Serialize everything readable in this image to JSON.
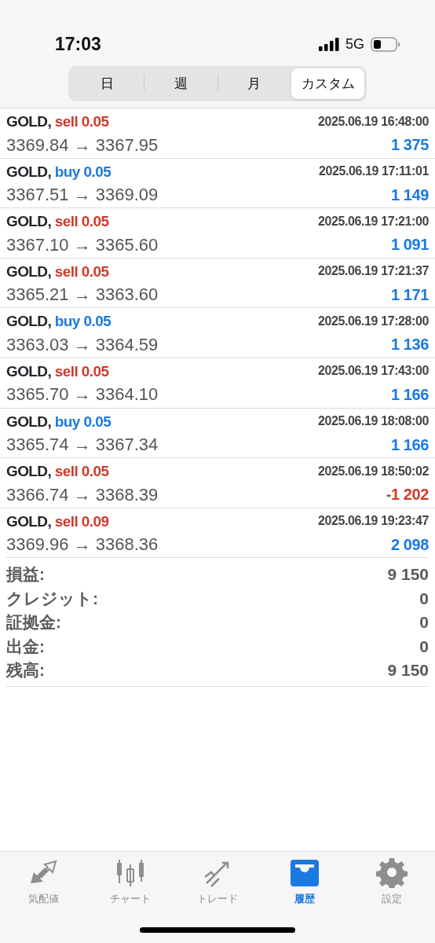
{
  "status_bar": {
    "time": "17:03",
    "network": "5G"
  },
  "period_tabs": [
    {
      "label": "日",
      "selected": false
    },
    {
      "label": "週",
      "selected": false
    },
    {
      "label": "月",
      "selected": false
    },
    {
      "label": "カスタム",
      "selected": true
    }
  ],
  "trades": [
    {
      "symbol": "GOLD,",
      "side": "sell",
      "lot": "0.05",
      "time": "2025.06.19 16:48:00",
      "prices": "3369.84 → 3367.95",
      "profit": "1 375",
      "negative": false
    },
    {
      "symbol": "GOLD,",
      "side": "buy",
      "lot": "0.05",
      "time": "2025.06.19 17:11:01",
      "prices": "3367.51 → 3369.09",
      "profit": "1 149",
      "negative": false
    },
    {
      "symbol": "GOLD,",
      "side": "sell",
      "lot": "0.05",
      "time": "2025.06.19 17:21:00",
      "prices": "3367.10 → 3365.60",
      "profit": "1 091",
      "negative": false
    },
    {
      "symbol": "GOLD,",
      "side": "sell",
      "lot": "0.05",
      "time": "2025.06.19 17:21:37",
      "prices": "3365.21 → 3363.60",
      "profit": "1 171",
      "negative": false
    },
    {
      "symbol": "GOLD,",
      "side": "buy",
      "lot": "0.05",
      "time": "2025.06.19 17:28:00",
      "prices": "3363.03 → 3364.59",
      "profit": "1 136",
      "negative": false
    },
    {
      "symbol": "GOLD,",
      "side": "sell",
      "lot": "0.05",
      "time": "2025.06.19 17:43:00",
      "prices": "3365.70 → 3364.10",
      "profit": "1 166",
      "negative": false
    },
    {
      "symbol": "GOLD,",
      "side": "buy",
      "lot": "0.05",
      "time": "2025.06.19 18:08:00",
      "prices": "3365.74 → 3367.34",
      "profit": "1 166",
      "negative": false
    },
    {
      "symbol": "GOLD,",
      "side": "sell",
      "lot": "0.05",
      "time": "2025.06.19 18:50:02",
      "prices": "3366.74 → 3368.39",
      "profit": "-1 202",
      "negative": true
    },
    {
      "symbol": "GOLD,",
      "side": "sell",
      "lot": "0.09",
      "time": "2025.06.19 19:23:47",
      "prices": "3369.96 → 3368.36",
      "profit": "2 098",
      "negative": false
    }
  ],
  "summary": [
    {
      "label": "損益:",
      "value": "9 150"
    },
    {
      "label": "クレジット:",
      "value": "0"
    },
    {
      "label": "証拠金:",
      "value": "0"
    },
    {
      "label": "出金:",
      "value": "0"
    },
    {
      "label": "残高:",
      "value": "9 150"
    }
  ],
  "tab_bar": [
    {
      "kind": "quotes",
      "label": "気配値",
      "selected": false
    },
    {
      "kind": "chart",
      "label": "チャート",
      "selected": false
    },
    {
      "kind": "trade",
      "label": "トレード",
      "selected": false
    },
    {
      "kind": "history",
      "label": "履歴",
      "selected": true
    },
    {
      "kind": "settings",
      "label": "設定",
      "selected": false
    }
  ]
}
